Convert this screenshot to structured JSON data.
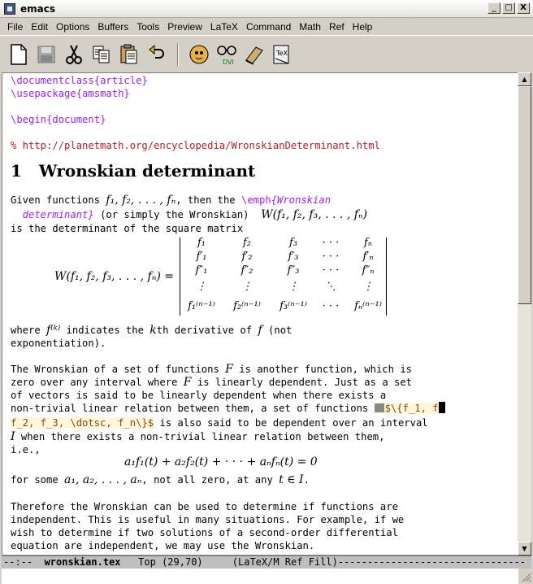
{
  "window": {
    "title": "emacs",
    "min": "_",
    "max": "□",
    "close": "X"
  },
  "menu": [
    "File",
    "Edit",
    "Options",
    "Buffers",
    "Tools",
    "Preview",
    "LaTeX",
    "Command",
    "Math",
    "Ref",
    "Help"
  ],
  "toolbar": {
    "buttons": [
      "new-file",
      "save",
      "cut",
      "copy",
      "paste",
      "undo",
      "latex",
      "dvi",
      "bibtex",
      "tex"
    ],
    "dvi_label": "DVI"
  },
  "buffer": {
    "l1a": "\\documentclass",
    "l1b": "{article}",
    "l2a": "\\usepackage",
    "l2b": "{amsmath}",
    "l3a": "\\begin",
    "l3b": "{document}",
    "l4": "% http://planetmath.org/encyclopedia/WronskianDeterminant.html",
    "section_num": "1",
    "section_title": "Wronskian determinant",
    "p1_l1a": "Given functions ",
    "p1_l1m": "f₁, f₂, . . . , fₙ",
    "p1_l1b": ", then the ",
    "p1_l1c": "\\emph",
    "p1_l1d": "{Wronskian",
    "p1_l2a": "  determinant}",
    "p1_l2b": " (or simply the Wronskian)  ",
    "p1_l2m": "W(f₁, f₂, f₃, . . . , fₙ)",
    "p1_l3": "is the determinant of the square matrix",
    "matrix_lhs": "W(f₁, f₂, f₃, . . . , fₙ) =",
    "m_r1": [
      "f₁",
      "f₂",
      "f₃",
      "· · ·",
      "fₙ"
    ],
    "m_r2": [
      "f′₁",
      "f′₂",
      "f′₃",
      "· · ·",
      "f′ₙ"
    ],
    "m_r3": [
      "f″₁",
      "f″₂",
      "f″₃",
      "· · ·",
      "f″ₙ"
    ],
    "m_r4": [
      "⋮",
      "⋮",
      "⋮",
      "⋱",
      "⋮"
    ],
    "m_r5": [
      "f₁⁽ⁿ⁻¹⁾",
      "f₂⁽ⁿ⁻¹⁾",
      "f₃⁽ⁿ⁻¹⁾",
      "· · ·",
      "fₙ⁽ⁿ⁻¹⁾"
    ],
    "p2_l1a": "where ",
    "p2_l1m": "f⁽ᵏ⁾",
    "p2_l1b": " indicates the ",
    "p2_l1m2": "k",
    "p2_l1c": "th derivative of ",
    "p2_l1m3": "f",
    "p2_l1d": " (not",
    "p2_l2": "exponentiation).",
    "p3_l1a": "The Wronskian of a set of functions ",
    "p3_l1m": "F",
    "p3_l1b": " is another function, which is",
    "p3_l2a": "zero over any interval where ",
    "p3_l2m": "F",
    "p3_l2b": " is linearly dependent. Just as a set",
    "p3_l3": "of vectors is said to be linearly dependent when there exists a",
    "p3_l4a": "non-trivial linear relation between them, a set of functions ",
    "p3_l4b": "$\\{f_1, f",
    "p3_l5a": "f_2, f_3, \\dotsc, f_n\\}$",
    "p3_l5b": " is also said to be dependent over an interval",
    "p3_l6m": "I",
    "p3_l6b": " when there exists a non-trivial linear relation between them,",
    "p3_l7": "i.e.,",
    "p3_eq": "a₁f₁(t) + a₂f₂(t) + · · · + aₙfₙ(t) = 0",
    "p3_l8a": "for some ",
    "p3_l8m": "a₁, a₂, . . . , aₙ",
    "p3_l8b": ", not all zero, at any ",
    "p3_l8m2": "t ∈ I",
    "p3_l8c": ".",
    "p4_l1": "Therefore the Wronskian can be used to determine if functions are",
    "p4_l2": "independent. This is useful in many situations. For example, if we",
    "p4_l3": "wish to determine if two solutions of a second-order differential",
    "p4_l4": "equation are independent, we may use the Wronskian."
  },
  "modeline": {
    "status": "--:--  ",
    "buffer_name": "wronskian.tex",
    "position": "   Top (29,70)     ",
    "modes": "(LaTeX/M Ref Fill)",
    "dashes": "--------------------------------"
  }
}
